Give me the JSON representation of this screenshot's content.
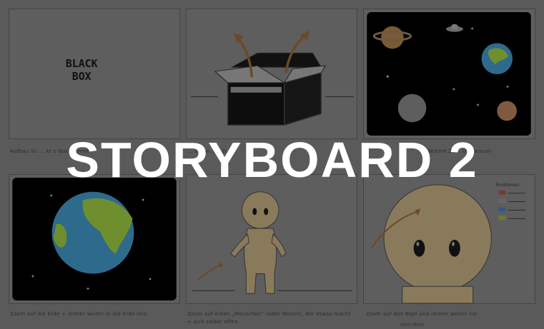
{
  "title": "STORYBOARD 2",
  "panels": [
    {
      "id": 1,
      "sketch_text": [
        "BLACK",
        "BOX"
      ]
    },
    {
      "id": 2
    },
    {
      "id": 3
    },
    {
      "id": 4
    },
    {
      "id": 5
    },
    {
      "id": 6,
      "legend_title": "Emotionen:"
    }
  ],
  "captions": {
    "row1_p1": "Aufbau Sc    ... kt o   Box  kommt",
    "row1_p2": "... u  Box  ... . D ...",
    "row1_p3": "Weitere Ze... Universum",
    "row2_p1": "Zoom auf die Erde + immer weiter in die Erde rein",
    "row2_p2a": "Zoom auf einen „Menschen“ (oder Wesen), der etwas macht",
    "row2_p2b": "+ sich selbst offen",
    "row2_p3a": "Zoom auf den Kopf und immer weiter ins",
    "row2_p3b": "rein Hirn"
  },
  "colors": {
    "background": "#5a5a5a",
    "panel": "#5e5e5e",
    "space": "#000000",
    "earth_ocean": "#2e6a8c",
    "earth_land": "#6f8f2e",
    "skin": "#8a7a5c",
    "title": "#ffffff"
  }
}
